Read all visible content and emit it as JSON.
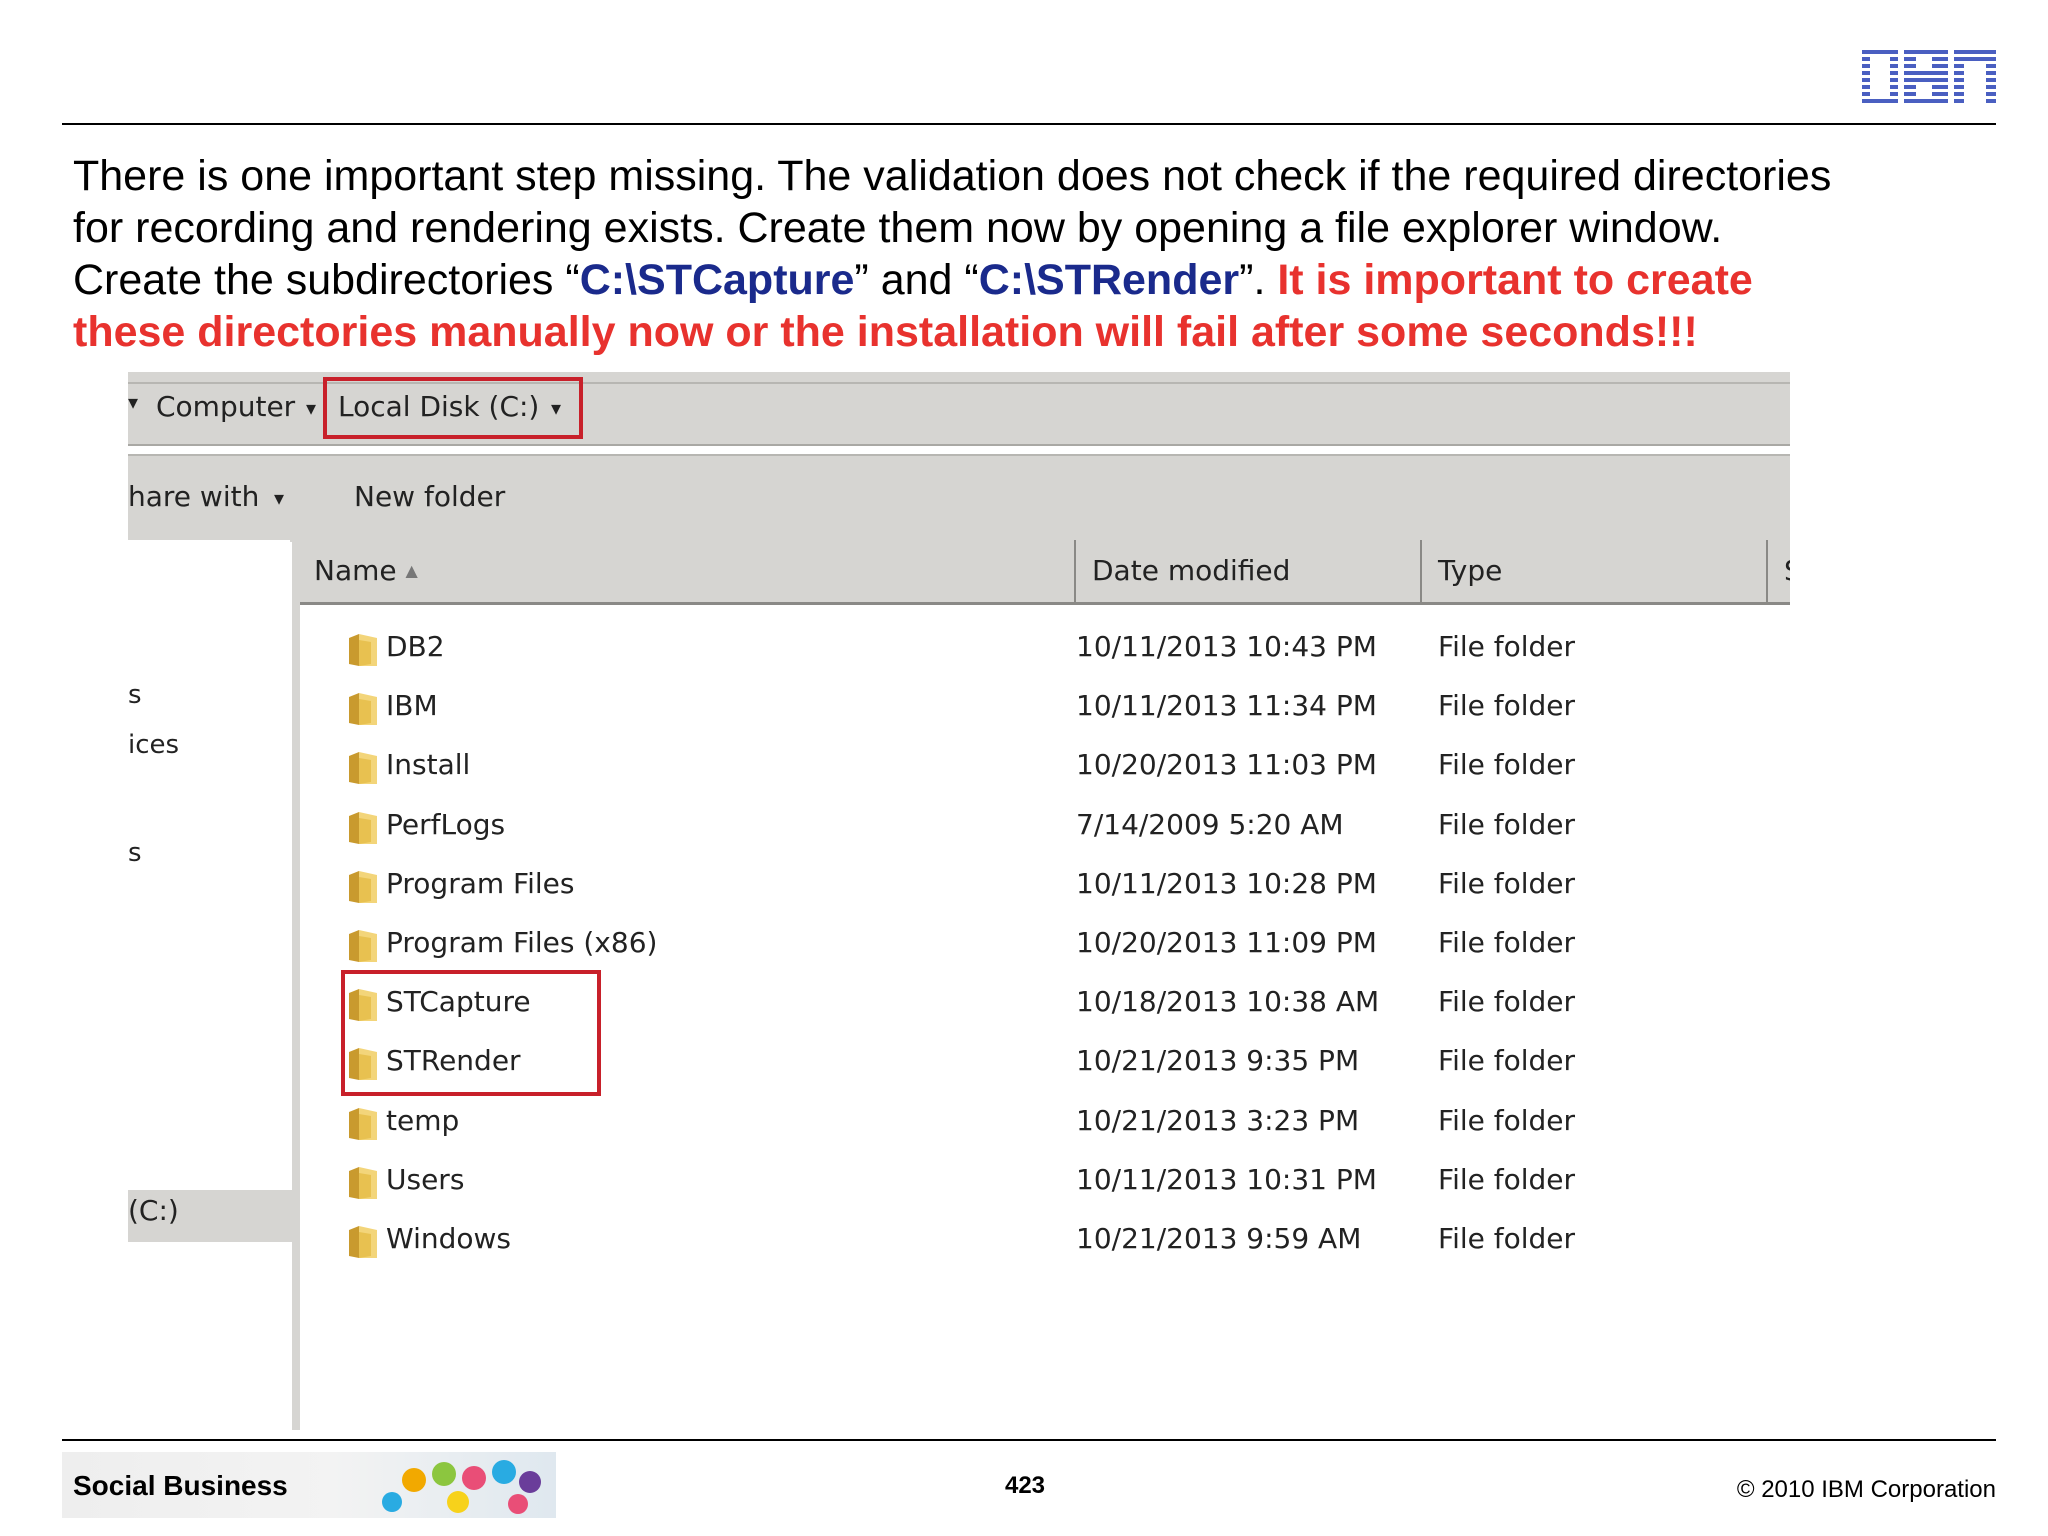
{
  "slide": {
    "logo_text": "IBM",
    "body": {
      "line1": "There is one important step missing. The validation does not check if the required directories",
      "line2": "for recording and rendering exists. Create them now by opening a file explorer window.",
      "line3_pre": "Create the subdirectories “",
      "path1": "C:\\STCapture",
      "mid": "” and “",
      "path2": "C:\\STRender",
      "post": "”. ",
      "warning_a": "It is important to create",
      "warning_b": "these directories manually now or the installation will fail after some seconds!!!"
    },
    "footer": {
      "brand": "Social Business",
      "page_number": "423",
      "copyright": "© 2010 IBM Corporation"
    }
  },
  "explorer": {
    "breadcrumb": {
      "computer": "Computer",
      "location": "Local Disk (C:)"
    },
    "toolbar": {
      "share": "hare with",
      "new_folder": "New folder"
    },
    "nav": {
      "item1": "s",
      "item2": "ices",
      "item3": "s",
      "drive": "(C:)"
    },
    "columns": {
      "name": "Name",
      "date": "Date modified",
      "type": "Type",
      "size": "S"
    },
    "files": [
      {
        "name": "DB2",
        "date": "10/11/2013 10:43 PM",
        "type": "File folder"
      },
      {
        "name": "IBM",
        "date": "10/11/2013 11:34 PM",
        "type": "File folder"
      },
      {
        "name": "Install",
        "date": "10/20/2013 11:03 PM",
        "type": "File folder"
      },
      {
        "name": "PerfLogs",
        "date": "7/14/2009 5:20 AM",
        "type": "File folder"
      },
      {
        "name": "Program Files",
        "date": "10/11/2013 10:28 PM",
        "type": "File folder"
      },
      {
        "name": "Program Files (x86)",
        "date": "10/20/2013 11:09 PM",
        "type": "File folder"
      },
      {
        "name": "STCapture",
        "date": "10/18/2013 10:38 AM",
        "type": "File folder"
      },
      {
        "name": "STRender",
        "date": "10/21/2013 9:35 PM",
        "type": "File folder"
      },
      {
        "name": "temp",
        "date": "10/21/2013 3:23 PM",
        "type": "File folder"
      },
      {
        "name": "Users",
        "date": "10/11/2013 10:31 PM",
        "type": "File folder"
      },
      {
        "name": "Windows",
        "date": "10/21/2013 9:59 AM",
        "type": "File folder"
      }
    ]
  },
  "colors": {
    "path": "#1a2a8c",
    "warning": "#e8322e",
    "highlight_box": "#c8202a",
    "ibm_blue": "#4a5fc1"
  }
}
